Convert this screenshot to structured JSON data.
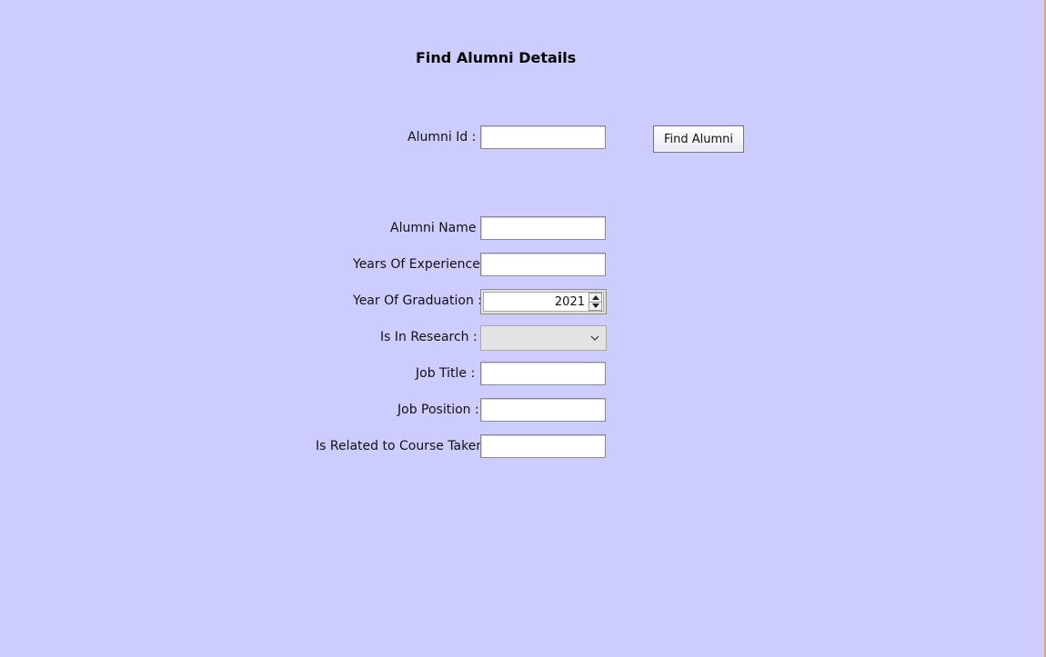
{
  "form": {
    "title": "Find Alumni Details",
    "alumni_id_label": "Alumni Id :",
    "alumni_id_value": "",
    "find_button_label": "Find Alumni",
    "alumni_name_label": "Alumni Name :",
    "alumni_name_value": "",
    "years_experience_label": "Years Of Experience :",
    "years_experience_value": "",
    "year_graduation_label": "Year Of Graduation :",
    "year_graduation_value": "2021",
    "is_in_research_label": "Is In Research :",
    "is_in_research_value": "",
    "job_title_label": "Job Title :",
    "job_title_value": "",
    "job_position_label": "Job Position :",
    "job_position_value": "",
    "is_related_label": "Is Related to Course Taken :",
    "is_related_value": ""
  },
  "icons": {
    "spinner_up": "chevron-up-icon",
    "spinner_down": "chevron-down-icon",
    "combo_arrow": "chevron-down-icon"
  },
  "colors": {
    "background": "#ccccff",
    "right_edge": "#f5a04a"
  }
}
